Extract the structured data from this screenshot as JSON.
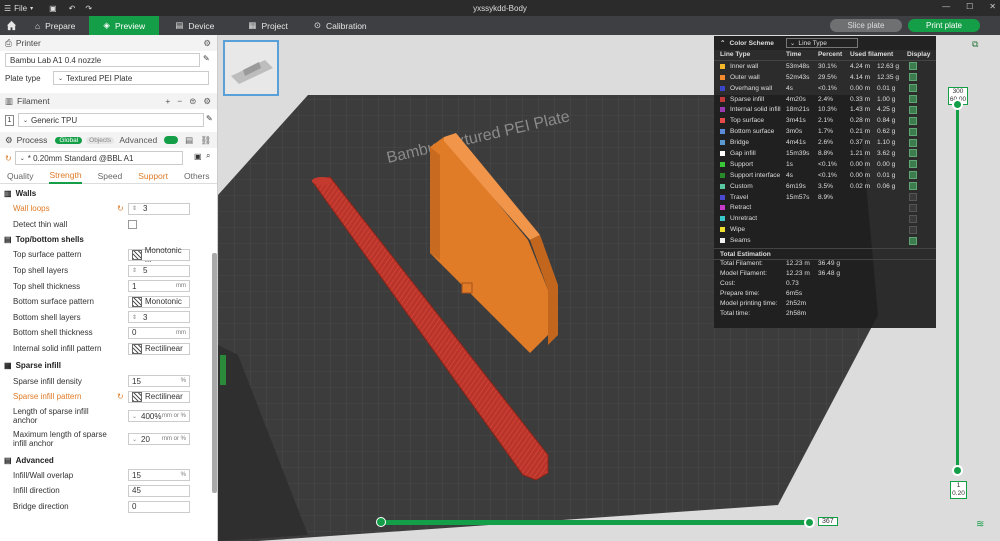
{
  "titlebar": {
    "file_label": "File",
    "title": "yxssykdd-Body"
  },
  "tabs": [
    {
      "label": "Prepare",
      "active": false
    },
    {
      "label": "Preview",
      "active": true
    },
    {
      "label": "Device",
      "active": false
    },
    {
      "label": "Project",
      "active": false
    },
    {
      "label": "Calibration",
      "active": false
    }
  ],
  "actions": {
    "slice": "Slice plate",
    "print": "Print plate"
  },
  "printer": {
    "section": "Printer",
    "model": "Bambu Lab A1 0.4 nozzle",
    "plate_type_label": "Plate type",
    "plate_type": "Textured PEI Plate"
  },
  "filament": {
    "section": "Filament",
    "slot": "1",
    "name": "Generic TPU"
  },
  "process": {
    "section": "Process",
    "global": "Global",
    "objects": "Objects",
    "advanced": "Advanced",
    "preset": "* 0.20mm Standard @BBL A1",
    "subtabs": [
      "Quality",
      "Strength",
      "Speed",
      "Support",
      "Others"
    ]
  },
  "settings": {
    "walls_title": "Walls",
    "wall_loops": {
      "label": "Wall loops",
      "value": "3"
    },
    "detect_thin_wall": {
      "label": "Detect thin wall"
    },
    "tb_title": "Top/bottom shells",
    "top_surface_pattern": {
      "label": "Top surface pattern",
      "value": "Monotonic ..."
    },
    "top_shell_layers": {
      "label": "Top shell layers",
      "value": "5"
    },
    "top_shell_thickness": {
      "label": "Top shell thickness",
      "value": "1",
      "unit": "mm"
    },
    "bottom_surface_pattern": {
      "label": "Bottom surface pattern",
      "value": "Monotonic"
    },
    "bottom_shell_layers": {
      "label": "Bottom shell layers",
      "value": "3"
    },
    "bottom_shell_thickness": {
      "label": "Bottom shell thickness",
      "value": "0",
      "unit": "mm"
    },
    "internal_solid_infill_pattern": {
      "label": "Internal solid infill pattern",
      "value": "Rectilinear"
    },
    "sparse_title": "Sparse infill",
    "sparse_infill_density": {
      "label": "Sparse infill density",
      "value": "15",
      "unit": "%"
    },
    "sparse_infill_pattern": {
      "label": "Sparse infill pattern",
      "value": "Rectilinear"
    },
    "length_sparse_anchor": {
      "label": "Length of sparse infill anchor",
      "value": "400%",
      "unit": "mm or %"
    },
    "max_length_sparse_anchor": {
      "label": "Maximum length of sparse infill anchor",
      "value": "20",
      "unit": "mm or %"
    },
    "advanced_title": "Advanced",
    "infill_wall_overlap": {
      "label": "Infill/Wall overlap",
      "value": "15",
      "unit": "%"
    },
    "infill_direction": {
      "label": "Infill direction",
      "value": "45"
    },
    "bridge_direction": {
      "label": "Bridge direction",
      "value": "0"
    }
  },
  "legend": {
    "title": "Color Scheme",
    "scheme": "Line Type",
    "columns": [
      "Line Type",
      "Time",
      "Percent",
      "Used filament",
      "Display"
    ],
    "rows": [
      {
        "name": "Inner wall",
        "color": "#f5b82a",
        "time": "53m48s",
        "pct": "30.1%",
        "len": "4.24 m",
        "g": "12.63 g",
        "on": true
      },
      {
        "name": "Outer wall",
        "color": "#f08a2c",
        "time": "52m43s",
        "pct": "29.5%",
        "len": "4.14 m",
        "g": "12.35 g",
        "on": true
      },
      {
        "name": "Overhang wall",
        "color": "#3a48c8",
        "time": "4s",
        "pct": "<0.1%",
        "len": "0.00 m",
        "g": "0.01 g",
        "on": true
      },
      {
        "name": "Sparse infill",
        "color": "#c43a3a",
        "time": "4m20s",
        "pct": "2.4%",
        "len": "0.33 m",
        "g": "1.00 g",
        "on": true
      },
      {
        "name": "Internal solid infill",
        "color": "#9a3ab0",
        "time": "18m21s",
        "pct": "10.3%",
        "len": "1.43 m",
        "g": "4.25 g",
        "on": true
      },
      {
        "name": "Top surface",
        "color": "#e84a4a",
        "time": "3m41s",
        "pct": "2.1%",
        "len": "0.28 m",
        "g": "0.84 g",
        "on": true
      },
      {
        "name": "Bottom surface",
        "color": "#5a8ad8",
        "time": "3m0s",
        "pct": "1.7%",
        "len": "0.21 m",
        "g": "0.62 g",
        "on": true
      },
      {
        "name": "Bridge",
        "color": "#5a9ad0",
        "time": "4m41s",
        "pct": "2.6%",
        "len": "0.37 m",
        "g": "1.10 g",
        "on": true
      },
      {
        "name": "Gap infill",
        "color": "#ffffff",
        "time": "15m39s",
        "pct": "8.8%",
        "len": "1.21 m",
        "g": "3.62 g",
        "on": true
      },
      {
        "name": "Support",
        "color": "#38c838",
        "time": "1s",
        "pct": "<0.1%",
        "len": "0.00 m",
        "g": "0.00 g",
        "on": true
      },
      {
        "name": "Support interface",
        "color": "#2a8a2a",
        "time": "4s",
        "pct": "<0.1%",
        "len": "0.00 m",
        "g": "0.01 g",
        "on": true
      },
      {
        "name": "Custom",
        "color": "#5ac8a0",
        "time": "6m19s",
        "pct": "3.5%",
        "len": "0.02 m",
        "g": "0.06 g",
        "on": true
      },
      {
        "name": "Travel",
        "color": "#4a4ad0",
        "time": "15m57s",
        "pct": "8.9%",
        "len": "",
        "g": "",
        "on": false
      },
      {
        "name": "Retract",
        "color": "#c83ac8",
        "time": "",
        "pct": "",
        "len": "",
        "g": "",
        "on": false
      },
      {
        "name": "Unretract",
        "color": "#3ac8c8",
        "time": "",
        "pct": "",
        "len": "",
        "g": "",
        "on": false
      },
      {
        "name": "Wipe",
        "color": "#f0e030",
        "time": "",
        "pct": "",
        "len": "",
        "g": "",
        "on": false
      },
      {
        "name": "Seams",
        "color": "#f0f0f0",
        "time": "",
        "pct": "",
        "len": "",
        "g": "",
        "on": true
      }
    ],
    "estimation_title": "Total Estimation",
    "estimation": [
      {
        "label": "Total Filament:",
        "v1": "12.23 m",
        "v2": "36.49 g"
      },
      {
        "label": "Model Filament:",
        "v1": "12.23 m",
        "v2": "36.48 g"
      },
      {
        "label": "Cost:",
        "v1": "0.73",
        "v2": ""
      },
      {
        "label": "Prepare time:",
        "v1": "6m5s",
        "v2": ""
      },
      {
        "label": "Model printing time:",
        "v1": "2h52m",
        "v2": ""
      },
      {
        "label": "Total time:",
        "v1": "2h58m",
        "v2": ""
      }
    ]
  },
  "bed_label": "Bambu Textured PEI Plate",
  "layer_slider": {
    "top_layer": "300",
    "top_height": "60.00",
    "bottom_layer": "1",
    "bottom_height": "0.20"
  },
  "move_slider": {
    "value": "367"
  },
  "colors": {
    "accent": "#159e48",
    "print": "#e07b28",
    "bed": "#3a3a3a"
  }
}
